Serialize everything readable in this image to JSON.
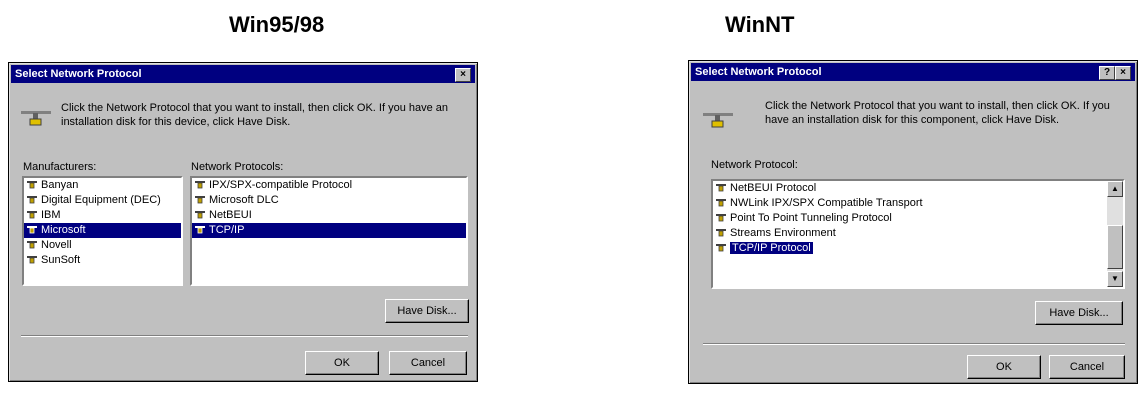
{
  "left": {
    "heading": "Win95/98",
    "title": "Select Network Protocol",
    "close_glyph": "×",
    "description": "Click the Network Protocol that you want to install, then click OK. If you have an installation disk for this device, click Have Disk.",
    "manufacturers_label": "Manufacturers:",
    "protocols_label": "Network Protocols:",
    "manufacturers": [
      "Banyan",
      "Digital Equipment (DEC)",
      "IBM",
      "Microsoft",
      "Novell",
      "SunSoft"
    ],
    "selected_manufacturer": "Microsoft",
    "protocols": [
      "IPX/SPX-compatible Protocol",
      "Microsoft DLC",
      "NetBEUI",
      "TCP/IP"
    ],
    "selected_protocol": "TCP/IP",
    "have_disk": "Have Disk...",
    "ok": "OK",
    "cancel": "Cancel"
  },
  "right": {
    "heading": "WinNT",
    "title": "Select Network Protocol",
    "help_glyph": "?",
    "close_glyph": "×",
    "description": "Click the Network Protocol that you want to install, then click OK. If you have an installation disk for this component, click Have Disk.",
    "protocol_label": "Network Protocol:",
    "protocols": [
      "NetBEUI Protocol",
      "NWLink IPX/SPX Compatible Transport",
      "Point To Point Tunneling Protocol",
      "Streams Environment",
      "TCP/IP Protocol"
    ],
    "selected_protocol": "TCP/IP Protocol",
    "have_disk": "Have Disk...",
    "ok": "OK",
    "cancel": "Cancel"
  }
}
